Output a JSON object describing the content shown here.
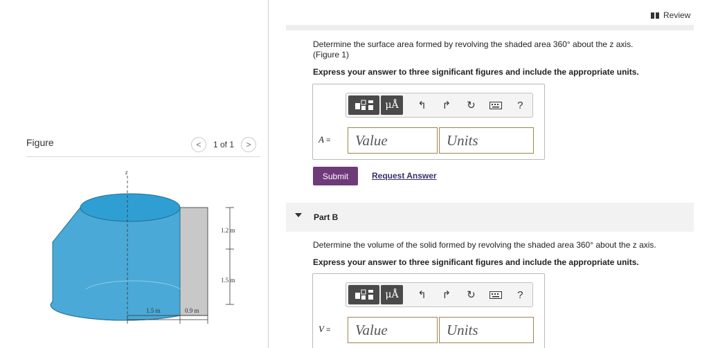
{
  "left": {
    "figure_label": "Figure",
    "counter": "1 of 1",
    "prev_glyph": "<",
    "next_glyph": ">",
    "diagram": {
      "axis_label": "z",
      "dim_1": "1.2 m",
      "dim_2": "1.5 m",
      "dim_3": "1.5 m",
      "dim_4": "0.9 m"
    }
  },
  "header": {
    "review_label": "Review"
  },
  "part_a": {
    "question": "Determine the surface area formed by revolving the shaded area 360° about the z axis.",
    "figure_ref": "(Figure 1)",
    "instruction": "Express your answer to three significant figures and include the appropriate units.",
    "var": "A",
    "eq": "=",
    "value_placeholder": "Value",
    "units_placeholder": "Units",
    "submit_label": "Submit",
    "request_label": "Request Answer"
  },
  "part_b": {
    "title": "Part B",
    "question": "Determine the volume of the solid formed by revolving the shaded area 360° about the z axis.",
    "instruction": "Express your answer to three significant figures and include the appropriate units.",
    "var": "V",
    "eq": "=",
    "value_placeholder": "Value",
    "units_placeholder": "Units"
  },
  "toolbar": {
    "mu_label": "μÅ",
    "help_label": "?",
    "icons": [
      "templates-icon",
      "units-icon",
      "undo-icon",
      "redo-icon",
      "reset-icon",
      "keyboard-icon",
      "help-icon"
    ]
  },
  "colors": {
    "submit": "#6f3a7a",
    "solid_top": "#2f9fd3",
    "solid_side": "#5bb8de",
    "shaded": "#c8c8c8"
  }
}
